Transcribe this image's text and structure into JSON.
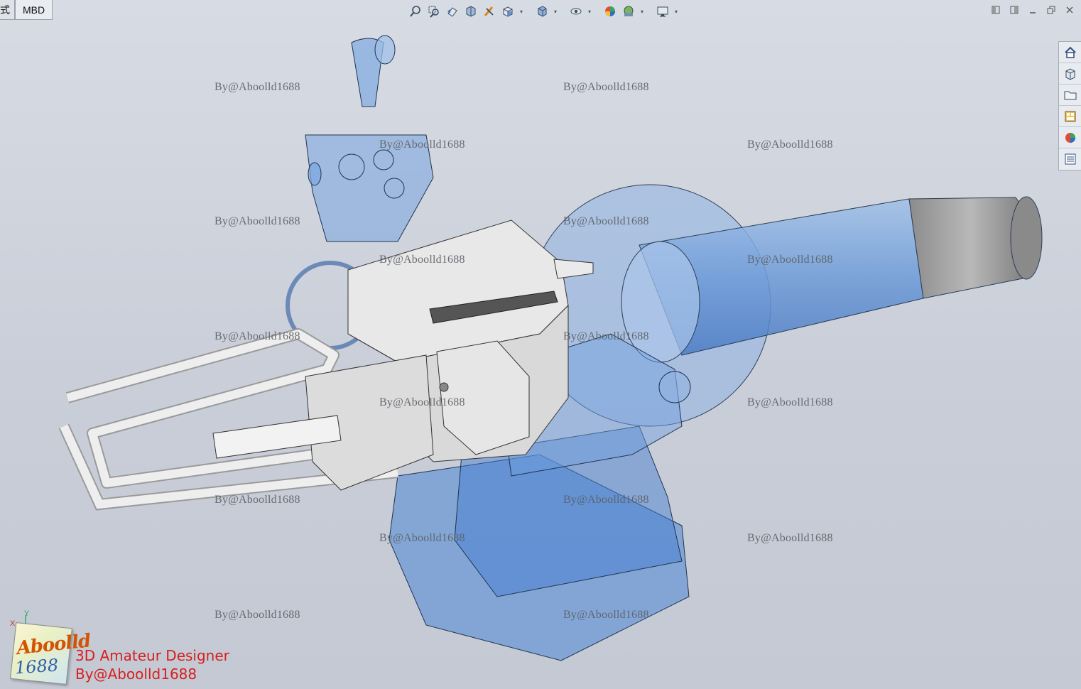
{
  "tabs": {
    "partial_tab": "式",
    "mbd_tab": "MBD"
  },
  "toolbar": {
    "icons": [
      "zoom-to-fit-icon",
      "zoom-to-area-icon",
      "previous-view-icon",
      "section-view-icon",
      "dynamic-annotation-icon",
      "view-orientation-icon",
      "display-style-icon",
      "hide-show-icon",
      "edit-appearance-icon",
      "apply-scene-icon",
      "view-settings-icon"
    ]
  },
  "taskpane": {
    "icons": [
      "home-icon",
      "parts-library-icon",
      "file-explorer-icon",
      "view-palette-icon",
      "appearances-icon",
      "custom-properties-icon"
    ]
  },
  "triad": {
    "x": "X",
    "y": "Y"
  },
  "watermark_text": "By@Aboolld1688",
  "logo": {
    "line1": "Aboolld",
    "line2": "1688"
  },
  "credit": {
    "line1": "3D Amateur Designer",
    "line2": "By@Aboolld1688"
  },
  "colors": {
    "background": "#cdd2db",
    "transparent_blue": "#5b8fd8",
    "metal_gray": "#e6e6e6",
    "credit_red": "#d71f1f"
  }
}
